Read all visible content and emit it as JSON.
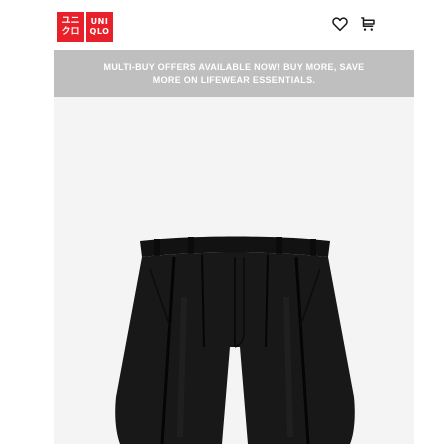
{
  "header": {
    "logo": {
      "left_top": "ユニ",
      "left_bottom": "クロ",
      "right_top": "UNI",
      "right_bottom": "QLO"
    },
    "icons": {
      "wishlist": "heart-icon",
      "cart": "cart-icon"
    }
  },
  "promo": {
    "line1": "MULTI-BUY OFFERS AVAILABLE NOW! BUY MORE, SAVE",
    "line2": "MORE ON LIFEWEAR ESSENTIALS."
  },
  "product": {
    "image_subject": "black pleated wide shorts"
  },
  "colors": {
    "brand_red": "#e8202a",
    "banner_gray": "#bfbfbf",
    "product_bg": "#f4f4f4",
    "garment": "#141414"
  }
}
